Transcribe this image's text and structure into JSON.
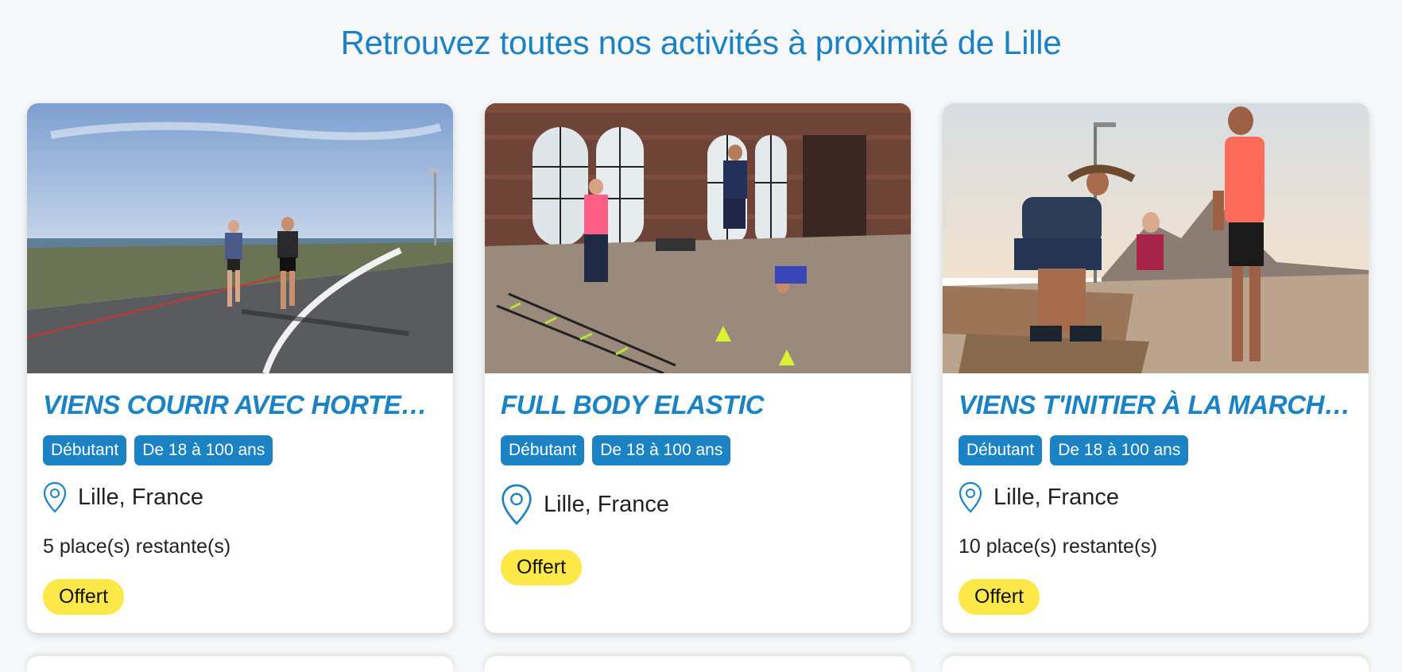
{
  "page": {
    "title": "Retrouvez toutes nos activités à proximité de Lille"
  },
  "colors": {
    "accent": "#1b82c4",
    "price_badge": "#fde84a",
    "background": "#f7f8f9"
  },
  "cards": [
    {
      "title": "VIENS COURIR AVEC HORTENSE !",
      "image": "road-running-photo",
      "tags": [
        "Débutant",
        "De 18 à 100 ans"
      ],
      "location": "Lille, France",
      "places": "5 place(s) restante(s)",
      "price": "Offert"
    },
    {
      "title": "FULL BODY ELASTIC",
      "image": "gym-training-photo",
      "tags": [
        "Débutant",
        "De 18 à 100 ans"
      ],
      "location": "Lille, France",
      "places": "",
      "price": "Offert"
    },
    {
      "title": "VIENS T'INITIER À LA MARCHE N…",
      "image": "seaside-walkers-photo",
      "tags": [
        "Débutant",
        "De 18 à 100 ans"
      ],
      "location": "Lille, France",
      "places": "10 place(s) restante(s)",
      "price": "Offert"
    }
  ]
}
